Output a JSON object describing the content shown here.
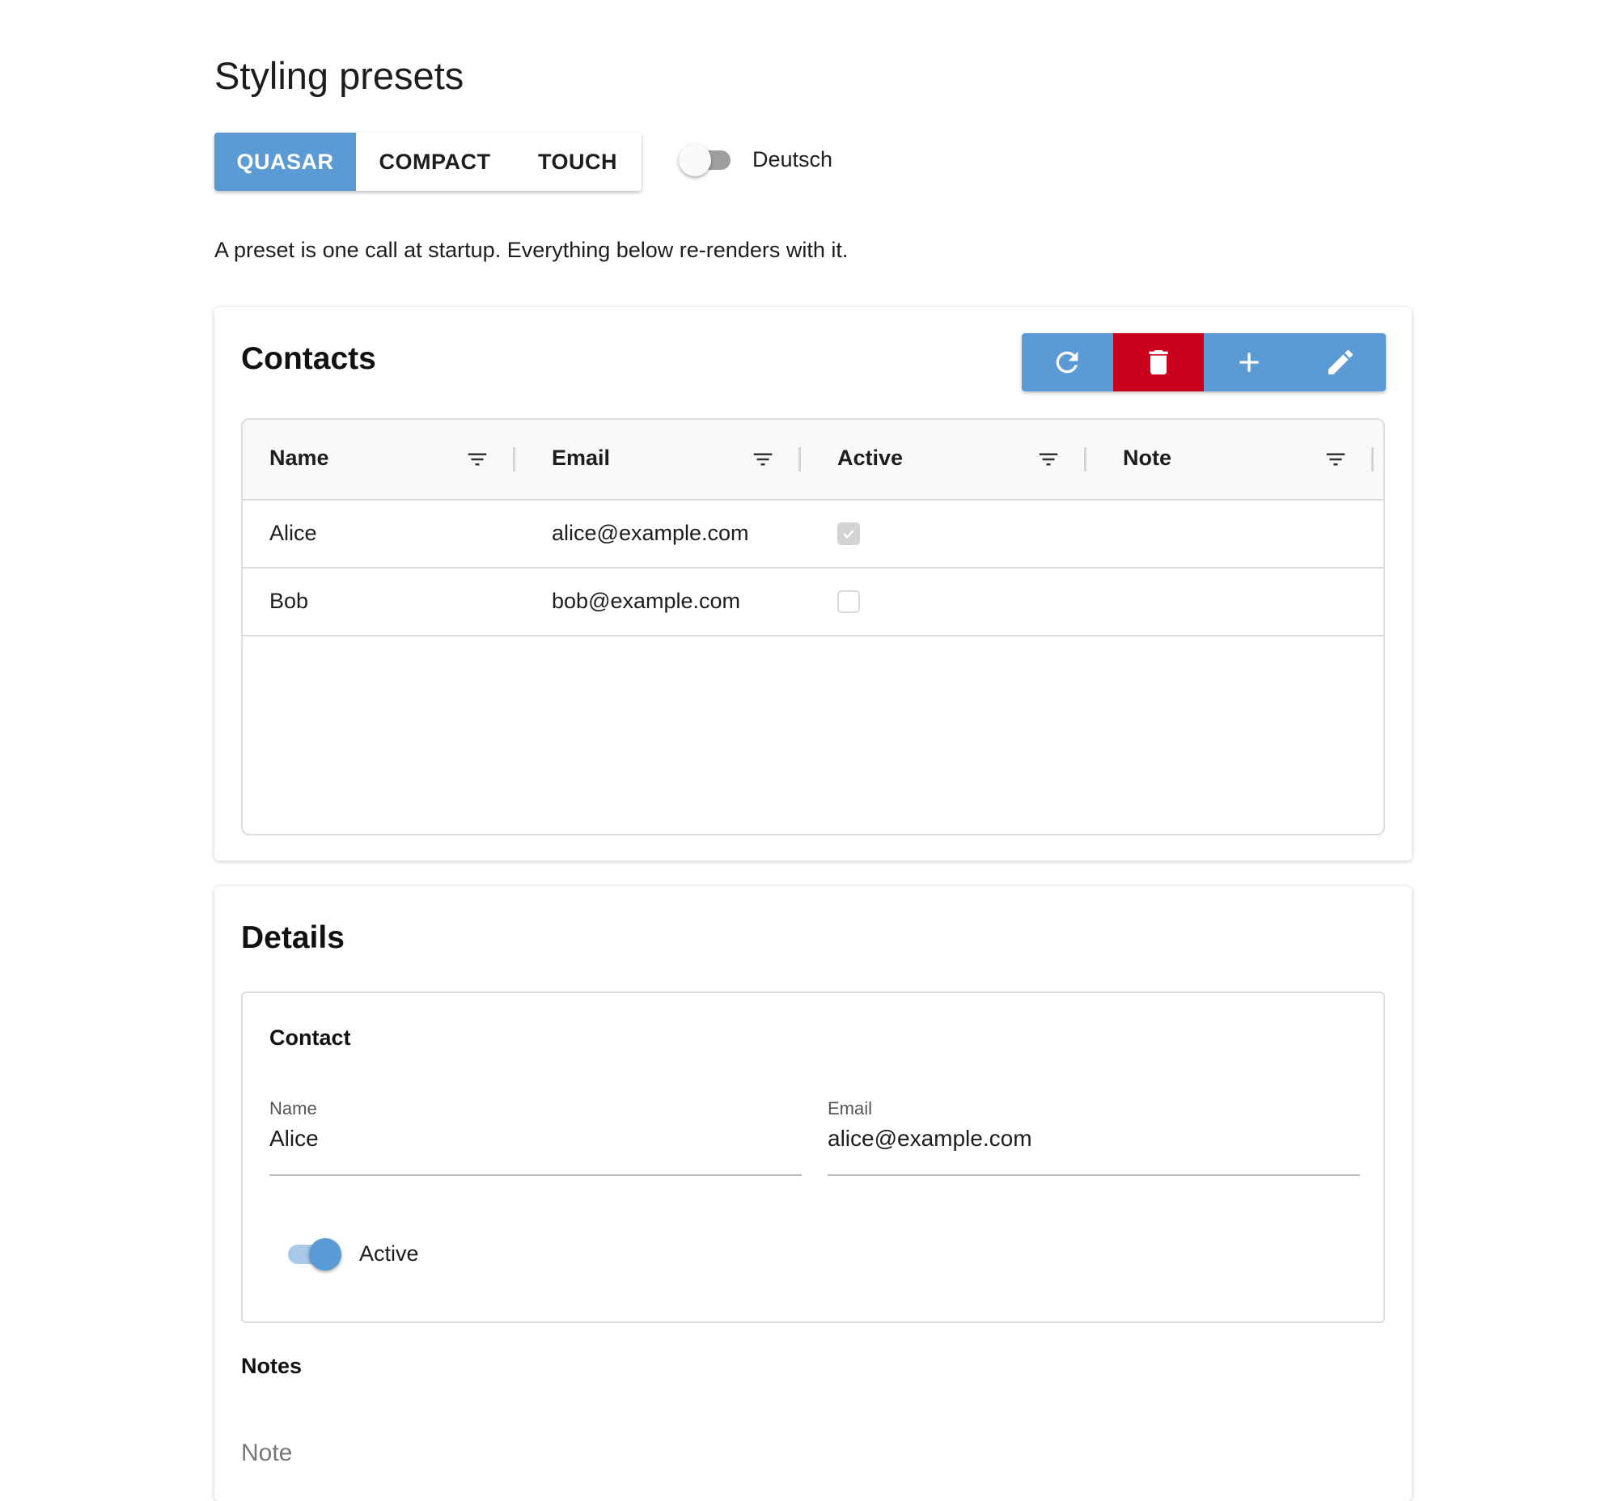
{
  "page": {
    "title": "Styling presets",
    "intro": "A preset is one call at startup. Everything below re-renders with it."
  },
  "presets": {
    "options": [
      "QUASAR",
      "COMPACT",
      "TOUCH"
    ],
    "selected": "QUASAR"
  },
  "language_toggle": {
    "label": "Deutsch",
    "on": false
  },
  "contacts": {
    "title": "Contacts",
    "toolbar": [
      {
        "action": "refresh",
        "icon": "refresh-icon"
      },
      {
        "action": "delete",
        "icon": "trash-icon"
      },
      {
        "action": "add",
        "icon": "plus-icon"
      },
      {
        "action": "edit",
        "icon": "pencil-icon"
      }
    ],
    "columns": [
      "Name",
      "Email",
      "Active",
      "Note"
    ],
    "rows": [
      {
        "name": "Alice",
        "email": "alice@example.com",
        "active": true,
        "note": ""
      },
      {
        "name": "Bob",
        "email": "bob@example.com",
        "active": false,
        "note": ""
      }
    ]
  },
  "details": {
    "title": "Details",
    "contact_legend": "Contact",
    "name_label": "Name",
    "name_value": "Alice",
    "email_label": "Email",
    "email_value": "alice@example.com",
    "active_label": "Active",
    "active_on": true,
    "notes_heading": "Notes",
    "note_placeholder": "Note"
  },
  "colors": {
    "primary": "#5b9bd5",
    "danger": "#c8001e",
    "border": "#dcdcdc"
  }
}
